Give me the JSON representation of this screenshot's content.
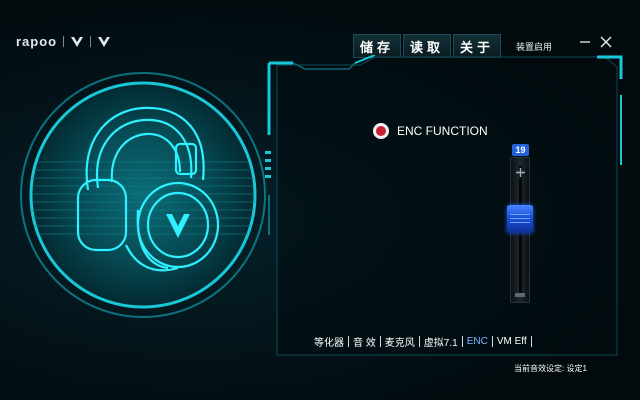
{
  "logo": {
    "brand": "rapoo",
    "mark1": "V",
    "mark2": "V"
  },
  "toolbar": {
    "save": "储存",
    "load": "读取",
    "about": "关于",
    "preset_enable": "装置启用"
  },
  "window": {
    "minimize_glyph": "—",
    "close_glyph": "✕"
  },
  "enc": {
    "label": "ENC FUNCTION",
    "selected": true
  },
  "slider": {
    "value": "19",
    "level_fraction": 0.5
  },
  "tabs": [
    {
      "label": "等化器"
    },
    {
      "label": "音 效"
    },
    {
      "label": "麦克风"
    },
    {
      "label": "虚拟7.1"
    },
    {
      "label": "ENC"
    },
    {
      "label": "VM Eff"
    }
  ],
  "status": {
    "text": "当前音效设定: 设定1"
  },
  "colors": {
    "accent_cyan": "#19c8d8",
    "active_tab": "#7fb4ff",
    "slider_blue": "#2563d9",
    "radio_red": "#c8202c"
  }
}
